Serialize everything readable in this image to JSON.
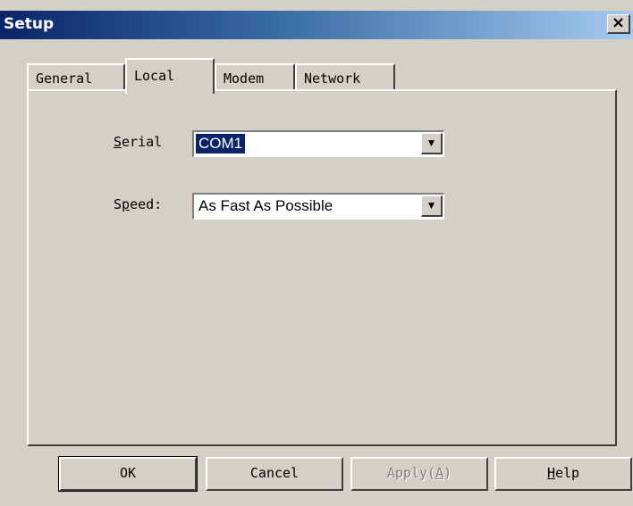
{
  "window": {
    "title": "Setup",
    "close_label": "×"
  },
  "tabs": [
    {
      "label": "General",
      "active": false
    },
    {
      "label": "Local",
      "active": true
    },
    {
      "label": "Modem",
      "active": false
    },
    {
      "label": "Network",
      "active": false
    }
  ],
  "local": {
    "serial": {
      "label_accel": "S",
      "label_rest": "erial",
      "value": "COM1"
    },
    "speed": {
      "label_pre": "S",
      "label_accel": "p",
      "label_rest": "eed:",
      "value": "As Fast As Possible"
    },
    "dropdown_arrow": "▼"
  },
  "buttons": {
    "ok": "OK",
    "cancel": "Cancel",
    "apply_pre": "Apply(",
    "apply_accel": "A",
    "apply_post": ")",
    "help_accel": "H",
    "help_rest": "elp"
  }
}
